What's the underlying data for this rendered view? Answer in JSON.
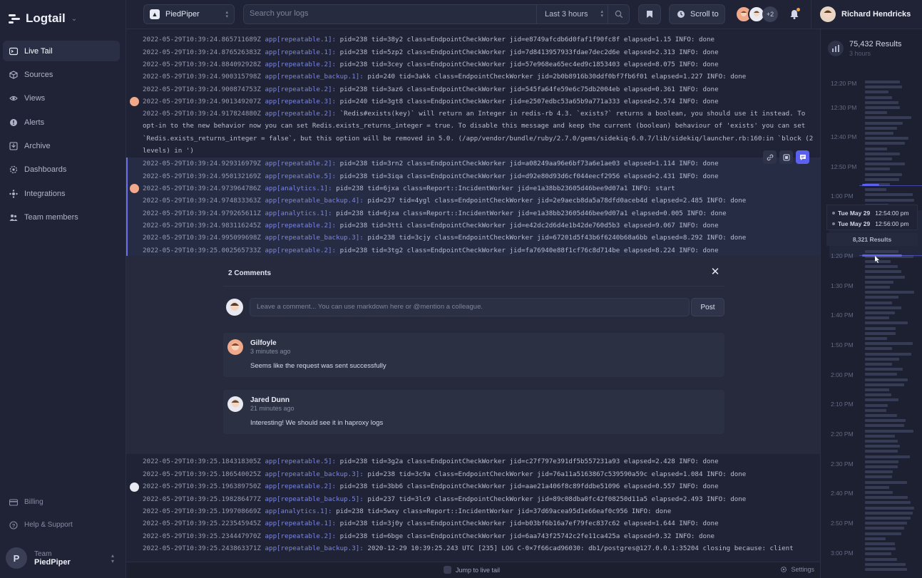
{
  "app": {
    "brand": "Logtail"
  },
  "sidebar": {
    "items": [
      {
        "label": "Live Tail",
        "icon": "terminal-icon",
        "active": true
      },
      {
        "label": "Sources",
        "icon": "cube-icon"
      },
      {
        "label": "Views",
        "icon": "eye-icon"
      },
      {
        "label": "Alerts",
        "icon": "alert-icon"
      },
      {
        "label": "Archive",
        "icon": "archive-icon"
      },
      {
        "label": "Dashboards",
        "icon": "dashboard-icon"
      },
      {
        "label": "Integrations",
        "icon": "integrations-icon"
      },
      {
        "label": "Team members",
        "icon": "team-icon"
      }
    ],
    "bottom": [
      {
        "label": "Billing",
        "icon": "card-icon"
      },
      {
        "label": "Help & Support",
        "icon": "help-icon"
      }
    ],
    "team": {
      "small": "Team",
      "name": "PiedPiper",
      "initial": "P"
    }
  },
  "topbar": {
    "source": "PiedPiper",
    "search_placeholder": "Search your logs",
    "time_range": "Last 3 hours",
    "scroll_to": "Scroll to",
    "more_viewers": "+2",
    "user_name": "Richard Hendricks"
  },
  "logs_top": [
    {
      "ts": "2022-05-29T10:39:24.865711689Z",
      "app": "app[repeatable.1]:",
      "msg": " pid=238 tid=38y2 class=EndpointCheckWorker jid=e8749afcdb6d0faf1f90fc8f elapsed=1.15 INFO: done"
    },
    {
      "ts": "2022-05-29T10:39:24.876526383Z",
      "app": "app[repeatable.1]:",
      "msg": " pid=238 tid=5zp2 class=EndpointCheckWorker jid=7d8413957933fdae7dec2d6e elapsed=2.313 INFO: done"
    },
    {
      "ts": "2022-05-29T10:39:24.884092928Z",
      "app": "app[repeatable.2]:",
      "msg": " pid=238 tid=3cey class=EndpointCheckWorker jid=57e968ea65ec4ed9c1853403 elapsed=8.075 INFO: done"
    },
    {
      "ts": "2022-05-29T10:39:24.900315798Z",
      "app": "app[repeatable_backup.1]:",
      "msg": " pid=240 tid=3akk class=EndpointCheckWorker jid=2b0b8916b30ddf0bf7fb6f01 elapsed=1.227 INFO: done"
    },
    {
      "ts": "2022-05-29T10:39:24.900874753Z",
      "app": "app[repeatable.2]:",
      "msg": " pid=238 tid=3az6 class=EndpointCheckWorker jid=545fa64fe59e6c75db2004eb elapsed=0.361 INFO: done"
    },
    {
      "ts": "2022-05-29T10:39:24.901349207Z",
      "app": "app[repeatable.3]:",
      "msg": " pid=240 tid=3gt8 class=EndpointCheckWorker jid=e2507edbc53a65b9a771a333 elapsed=2.574 INFO: done"
    }
  ],
  "log_long": {
    "ts": "2022-05-29T10:39:24.917824880Z",
    "app": "app[repeatable.2]:",
    "msg": " `Redis#exists(key)` will return an Integer in redis-rb 4.3. `exists?` returns a boolean, you should use it instead. To opt-in to the new behavior now you can set Redis.exists_returns_integer =  true. To disable this message and keep the current (boolean) behaviour of 'exists' you can set `Redis.exists_returns_integer = false`, but this option will be removed in 5.0. (/app/vendor/bundle/ruby/2.7.0/gems/sidekiq-6.0.7/lib/sidekiq/launcher.rb:160:in `block (2 levels) in  ')"
  },
  "logs_selected": [
    {
      "ts": "2022-05-29T10:39:24.929316979Z",
      "app": "app[repeatable.2]:",
      "msg": " pid=238 tid=3rn2 class=EndpointCheckWorker jid=a08249aa96e6bf73a6e1ae03 elapsed=1.114 INFO: done"
    },
    {
      "ts": "2022-05-29T10:39:24.950132169Z",
      "app": "app[repeatable.5]:",
      "msg": " pid=238 tid=3iqa class=EndpointCheckWorker jid=d92e80d93d6cf044eecf2956 elapsed=2.431 INFO: done"
    },
    {
      "ts": "2022-05-29T10:39:24.973964786Z",
      "app": "app[analytics.1]:",
      "msg": " pid=238 tid=6jxa class=Report::IncidentWorker jid=e1a38bb23605d46bee9d07a1 INFO: start"
    },
    {
      "ts": "2022-05-29T10:39:24.974833363Z",
      "app": "app[repeatable_backup.4]:",
      "msg": " pid=237 tid=4ygl class=EndpointCheckWorker jid=2e9aecb8da5a78dfd0aceb4d elapsed=2.485 INFO: done"
    },
    {
      "ts": "2022-05-29T10:39:24.979265611Z",
      "app": "app[analytics.1]:",
      "msg": " pid=238 tid=6jxa class=Report::IncidentWorker jid=e1a38bb23605d46bee9d07a1 elapsed=0.005 INFO: done"
    },
    {
      "ts": "2022-05-29T10:39:24.983116245Z",
      "app": "app[repeatable.2]:",
      "msg": " pid=238 tid=3tti class=EndpointCheckWorker jid=e42dc2d6d4e1b42de760d5b3 elapsed=9.067 INFO: done"
    },
    {
      "ts": "2022-05-29T10:39:24.995099698Z",
      "app": "app[repeatable_backup.3]:",
      "msg": " pid=238 tid=3cjy class=EndpointCheckWorker jid=67201d5f43b6f6240b68a6bb elapsed=8.292 INFO: done"
    },
    {
      "ts": "2022-05-29T10:39:25.002565733Z",
      "app": "app[repeatable.2]:",
      "msg": " pid=238 tid=3tg2 class=EndpointCheckWorker jid=fa76940e88f1cf76c8d714be elapsed=8.224 INFO: done"
    }
  ],
  "comments": {
    "title": "2 Comments",
    "placeholder": "Leave a comment... You can use markdown here or @mention a colleague.",
    "post_label": "Post",
    "items": [
      {
        "author": "Gilfoyle",
        "time": "3 minutes ago",
        "body": "Seems like the request was sent successfully"
      },
      {
        "author": "Jared Dunn",
        "time": "21 minutes ago",
        "body": "Interesting! We should see it in haproxy logs"
      }
    ]
  },
  "logs_bottom": [
    {
      "ts": "2022-05-29T10:39:25.184318305Z",
      "app": "app[repeatable.5]:",
      "msg": " pid=238 tid=3g2a class=EndpointCheckWorker jid=c27f797e391df5b557231a93 elapsed=2.428 INFO: done"
    },
    {
      "ts": "2022-05-29T10:39:25.186540025Z",
      "app": "app[repeatable_backup.3]:",
      "msg": " pid=238 tid=3c9a class=EndpointCheckWorker jid=76a11a5163867c539590a59c elapsed=1.084 INFO: done"
    },
    {
      "ts": "2022-05-29T10:39:25.196389750Z",
      "app": "app[repeatable.2]:",
      "msg": " pid=238 tid=3bb6 class=EndpointCheckWorker jid=aae21a406f8c89fddbe51096 elapsed=0.557 INFO: done"
    },
    {
      "ts": "2022-05-29T10:39:25.198286477Z",
      "app": "app[repeatable_backup.5]:",
      "msg": " pid=237 tid=3lc9 class=EndpointCheckWorker jid=89c08dba0fc42f08250d11a5 elapsed=2.493 INFO: done"
    },
    {
      "ts": "2022-05-29T10:39:25.199708669Z",
      "app": "app[analytics.1]:",
      "msg": " pid=238 tid=5wxy class=Report::IncidentWorker jid=37d69acea95d1e66eaf0c956 INFO: done"
    },
    {
      "ts": "2022-05-29T10:39:25.223545945Z",
      "app": "app[repeatable.1]:",
      "msg": " pid=238 tid=3j0y class=EndpointCheckWorker jid=b03bf6b16a7ef79fec837c62 elapsed=1.644 INFO: done"
    },
    {
      "ts": "2022-05-29T10:39:25.234447970Z",
      "app": "app[repeatable.2]:",
      "msg": " pid=238 tid=6bge class=EndpointCheckWorker jid=6aa743f25742c2fe11ca425a elapsed=9.32 INFO: done"
    },
    {
      "ts": "2022-05-29T10:39:25.243863371Z",
      "app": "app[repeatable_backup.3]:",
      "msg": " 2020-12-29 10:39:25.243 UTC [235] LOG C-0×7f66cad96030: db1/postgres@127.0.0.1:35204 closing because: client"
    }
  ],
  "footer": {
    "jump": "Jump to live tail",
    "settings": "Settings"
  },
  "histogram": {
    "results_count": "75,432 Results",
    "results_window": "3 hours",
    "time_labels": [
      "12:20 PM",
      "12:30 PM",
      "12:40 PM",
      "12:50 PM",
      "1:00 PM",
      "1:20 PM",
      "1:30 PM",
      "1:40 PM",
      "1:50 PM",
      "2:00 PM",
      "2:10 PM",
      "2:20 PM",
      "2:30 PM",
      "2:40 PM",
      "2:50 PM",
      "3:00 PM"
    ],
    "range_start_date": "Tue May 29",
    "range_start_time": "12:54:00 pm",
    "range_end_date": "Tue May 29",
    "range_end_time": "12:56:00 pm",
    "range_results": "8,321 Results"
  },
  "colors": {
    "accent": "#5b61ee",
    "app_tag": "#7c86e0",
    "background": "#1f2335"
  }
}
